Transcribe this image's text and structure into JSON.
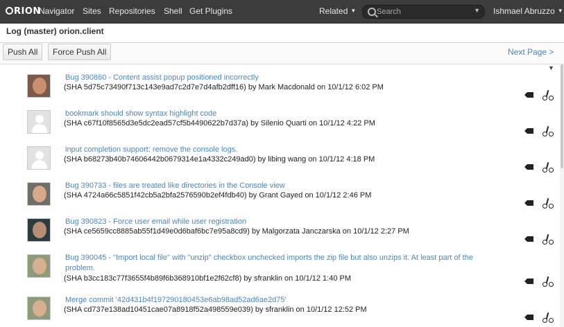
{
  "banner": {
    "brand": "RION",
    "nav": [
      "Navigator",
      "Sites",
      "Repositories",
      "Shell",
      "Get Plugins"
    ],
    "related": "Related",
    "search_placeholder": "Search",
    "user": "Ishmael Abruzzo"
  },
  "title": "Log (master) orion.client",
  "toolbar": {
    "push_all": "Push All",
    "force_push_all": "Force Push All",
    "next_page": "Next Page >"
  },
  "commits": [
    {
      "message": "Bug 390860 - Content assist popup positioned incorrectly",
      "meta": "(SHA 5d75c73490f713c143e9ad7c2d7e7d4afb2dff16) by Mark Macdonald on 10/1/12 6:02 PM",
      "avatar": "photo",
      "skin": "#c9906f",
      "bgcolor": "#7a5a4a"
    },
    {
      "message": "bookmark should show syntax highlight code",
      "meta": "(SHA c67f10f8565d3e5dc2ead57cf5b4490622b7d37a) by Silenio Quarti on 10/1/12 4:22 PM",
      "avatar": "gray"
    },
    {
      "message": "input completion support: remove the console logs.",
      "meta": "(SHA b68273b40b74606442b0679314e1a4332c249ad0) by libing wang on 10/1/12 4:18 PM",
      "avatar": "gray"
    },
    {
      "message": "Bug 390733 - files are treated like directories in the Console view",
      "meta": "(SHA 4724a66c5851f42cb5a2bfa2576590b2ef4fdb40) by Grant Gayed on 10/1/12 2:46 PM",
      "avatar": "photo",
      "skin": "#d7a98a",
      "bgcolor": "#6f6e6a"
    },
    {
      "message": "Bug 390823 - Force user email while user registration",
      "meta": "(SHA ce5659cc8885ab55f1d49e0d6baf6bc7e95a8cd9) by Malgorzata Janczarska on 10/1/12 2:27 PM",
      "avatar": "photo",
      "skin": "#b78e73",
      "bgcolor": "#2c3c3e"
    },
    {
      "message": "Bug 390045 - \"Import local file\" with \"unzip\" checkbox unchecked imports the zip file but also unzips it. At least part of the problem.",
      "meta": "(SHA b3cc183c77f3655f4b89f6b368910bf1e2f62cf8) by sfranklin on 10/1/12 1:40 PM",
      "avatar": "photo",
      "skin": "#d6b08f",
      "bgcolor": "#8f9a7a"
    },
    {
      "message": "Merge commit '42d431b4f197290180453e6ab98ad52ad6ae2d75'",
      "meta": "(SHA cd737e138ad10451cae07a8918f52a498559e039) by sfranklin on 10/1/12 12:52 PM",
      "avatar": "photo",
      "skin": "#d6b08f",
      "bgcolor": "#8f9a7a"
    }
  ]
}
